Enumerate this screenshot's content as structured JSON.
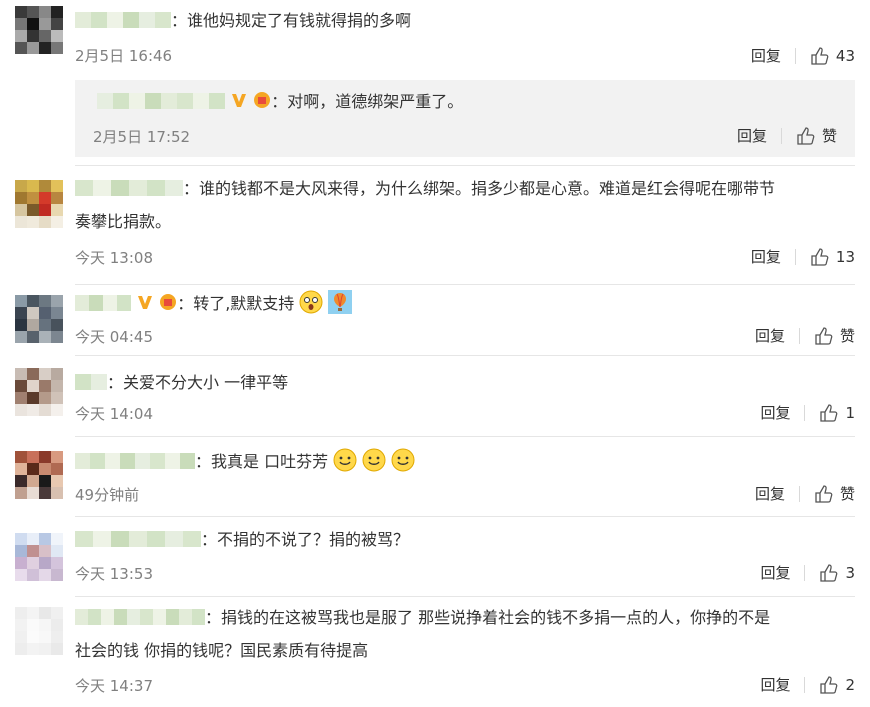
{
  "comments": [
    {
      "text": "：谁他妈规定了有钱就得捐的多啊",
      "time": "2月5日 16:46",
      "reply_label": "回复",
      "likes": "43",
      "reply": {
        "text": "：对啊，道德绑架严重了。",
        "time": "2月5日 17:52",
        "reply_label": "回复",
        "likes": "赞"
      }
    },
    {
      "text_line1": "：谁的钱都不是大风来得，为什么绑架。捐多少都是心意。难道是红会得呢在哪带节",
      "text_line2": "奏攀比捐款。",
      "time": "今天 13:08",
      "reply_label": "回复",
      "likes": "13"
    },
    {
      "text": "：转了,默默支持",
      "time": "今天 04:45",
      "reply_label": "回复",
      "likes": "赞"
    },
    {
      "text": "：关爱不分大小 一律平等",
      "time": "今天 14:04",
      "reply_label": "回复",
      "likes": "1"
    },
    {
      "text": "：我真是 口吐芬芳",
      "time": "49分钟前",
      "reply_label": "回复",
      "likes": "赞"
    },
    {
      "text": "：不捐的不说了？捐的被骂？",
      "time": "今天 13:53",
      "reply_label": "回复",
      "likes": "3"
    },
    {
      "text_line1": "：捐钱的在这被骂我也是服了 那些说挣着社会的钱不多捐一点的人，你挣的不是",
      "text_line2": "社会的钱 你捐的钱呢？国民素质有待提高",
      "time": "今天 14:37",
      "reply_label": "回复",
      "likes": "2"
    }
  ],
  "icons": {
    "thumb": "thumbs-up-icon",
    "vip": "vip-v-icon",
    "smile": "smile-emoji-icon",
    "shock": "shock-emoji-icon",
    "balloon": "balloon-emoji-icon"
  },
  "colors": {
    "text": "#333333",
    "meta": "#808080",
    "reply_bg": "#f2f2f2",
    "divider": "#e6e6e6",
    "vip": "#f5a623"
  }
}
